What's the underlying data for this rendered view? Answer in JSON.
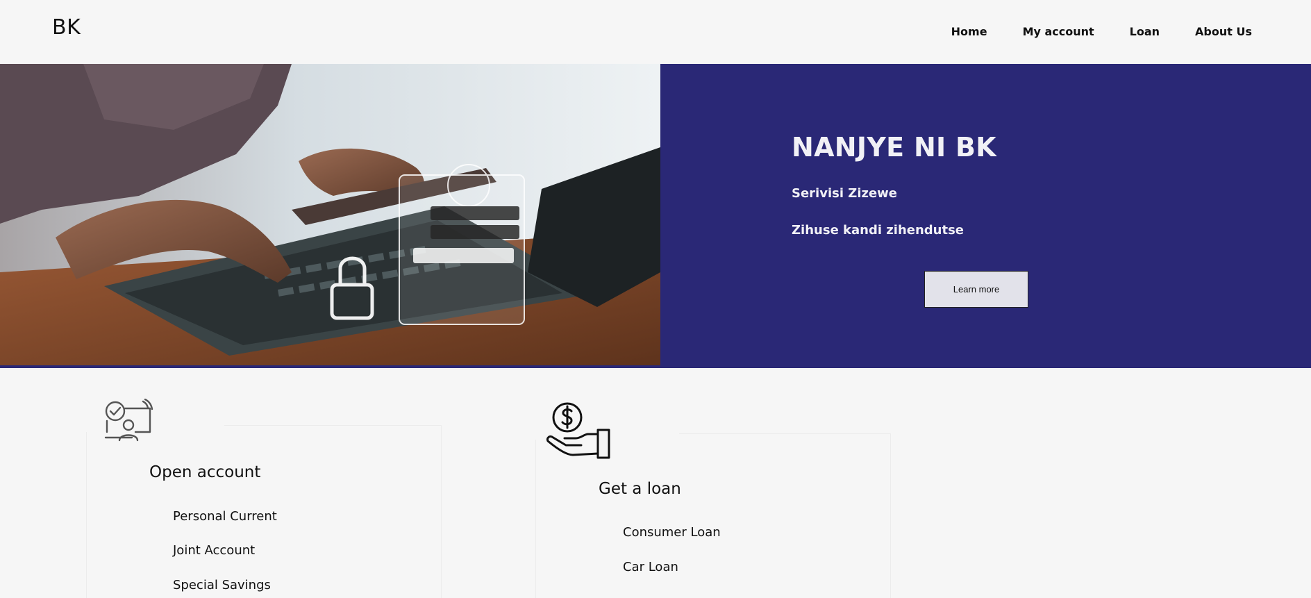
{
  "header": {
    "logo": "BK",
    "nav": [
      {
        "label": "Home"
      },
      {
        "label": "My account"
      },
      {
        "label": "Loan"
      },
      {
        "label": "About Us"
      }
    ]
  },
  "hero": {
    "title": "NANJYE NI BK",
    "subtitle_1": "Serivisi Zizewe",
    "subtitle_2": "Zihuse kandi zihendutse",
    "button_label": "Learn more",
    "panel_color": "#2a2876",
    "image_icon": "laptop-login-photo"
  },
  "cards": [
    {
      "icon": "online-account-icon",
      "title": "Open account",
      "items": [
        "Personal Current",
        "Joint Account",
        "Special Savings"
      ]
    },
    {
      "icon": "dollar-hand-icon",
      "title": "Get a loan",
      "items": [
        "Consumer Loan",
        "Car Loan"
      ]
    }
  ]
}
